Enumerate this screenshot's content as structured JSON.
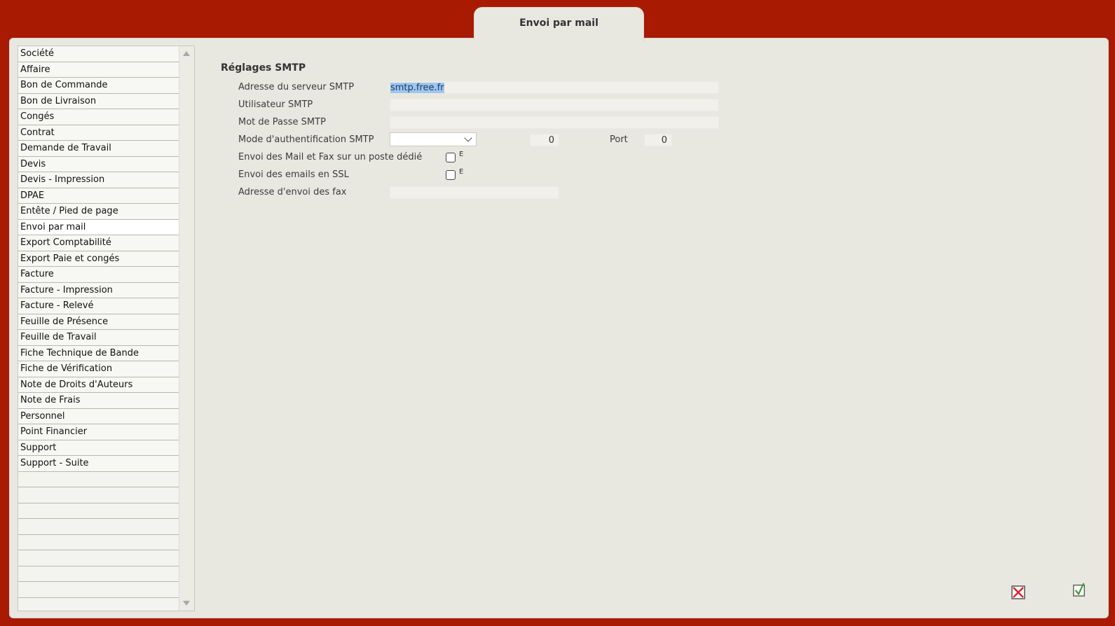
{
  "tab": {
    "title": "Envoi par mail"
  },
  "sidebar": {
    "items": [
      "Société",
      "Affaire",
      "Bon de Commande",
      "Bon de Livraison",
      "Congés",
      "Contrat",
      "Demande de Travail",
      "Devis",
      "Devis - Impression",
      "DPAE",
      "Entête / Pied de page",
      "Envoi par mail",
      "Export Comptabilité",
      "Export Paie et congés",
      "Facture",
      "Facture - Impression",
      "Facture - Relevé",
      "Feuille de Présence",
      "Feuille de Travail",
      "Fiche Technique de Bande",
      "Fiche de Vérification",
      "Note de Droits d'Auteurs",
      "Note de Frais",
      "Personnel",
      "Point Financier",
      "Support",
      "Support - Suite"
    ],
    "selected": "Envoi par mail",
    "empty_rows": 9
  },
  "form": {
    "section_title": "Réglages SMTP",
    "smtp_server_label": "Adresse du serveur SMTP",
    "smtp_server_value": "smtp.free.fr",
    "smtp_user_label": "Utilisateur SMTP",
    "smtp_user_value": "",
    "smtp_password_label": "Mot de Passe SMTP",
    "smtp_password_value": "",
    "auth_mode_label": "Mode d'authentification SMTP",
    "auth_mode_value": "",
    "auth_number_value": "0",
    "port_label": "Port",
    "port_value": "0",
    "dedicated_post_label": "Envoi des Mail et Fax sur un poste dédié",
    "dedicated_post_checked": false,
    "dedicated_post_tail": "E",
    "ssl_label": "Envoi des emails en SSL",
    "ssl_checked": false,
    "ssl_tail": "E",
    "fax_address_label": "Adresse d'envoi des fax",
    "fax_address_value": ""
  },
  "colors": {
    "frame": "#a81a02",
    "panel": "#e8e7e0",
    "selection": "#9fc6ee",
    "cancel": "#e0202a",
    "confirm": "#3aa02c"
  },
  "icons": {
    "cancel": "cancel-x-icon",
    "confirm": "confirm-check-icon"
  }
}
